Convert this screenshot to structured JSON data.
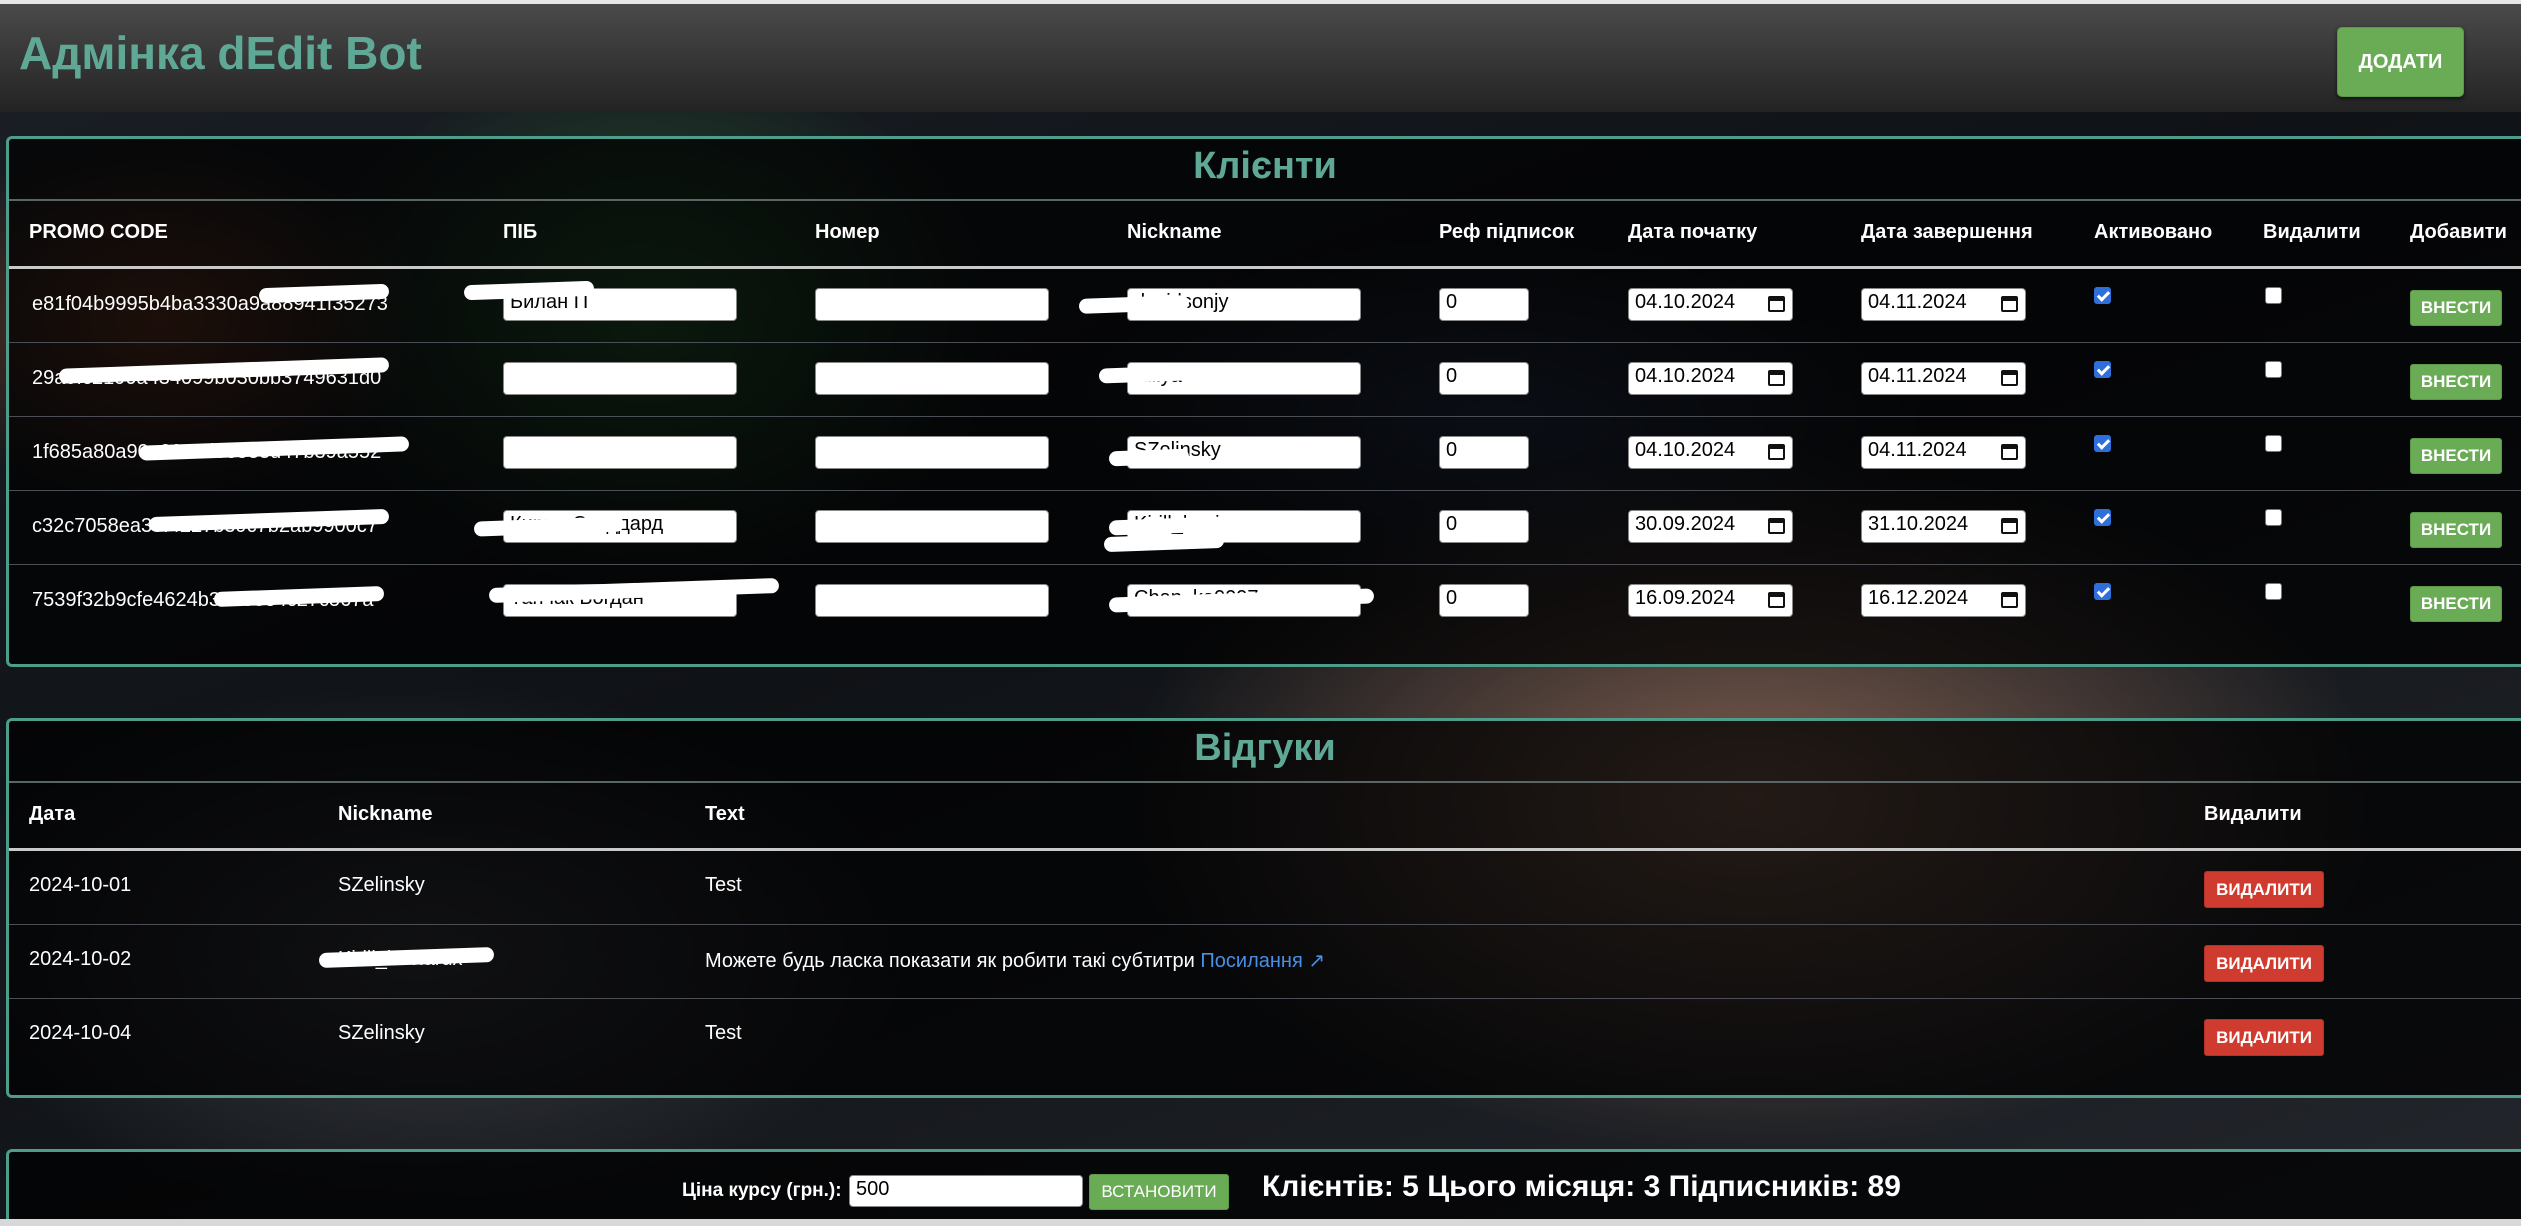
{
  "header": {
    "title": "Адмінка dEdit Bot",
    "add_button": "ДОДАТИ"
  },
  "clients": {
    "title": "Клієнти",
    "columns": [
      "PROMO CODE",
      "ПІБ",
      "Номер",
      "Nickname",
      "Реф підписок",
      "Дата початку",
      "Дата завершення",
      "Активовано",
      "Видалити",
      "Добавити"
    ],
    "submit_label": "ВНЕСТИ",
    "rows": [
      {
        "promo": "e81f04b9995b4ba3330a9a88941f35273",
        "name": "Билан П",
        "phone": "",
        "nickname": "davidsonjy",
        "ref": "0",
        "start": "04.10.2024",
        "end": "04.11.2024",
        "activated": true,
        "delete": false
      },
      {
        "promo": "29a9fc2190a434099b030bb3749631d0",
        "name": "",
        "phone": "",
        "nickname": "Kiilya",
        "ref": "0",
        "start": "04.10.2024",
        "end": "04.11.2024",
        "activated": true,
        "delete": false
      },
      {
        "promo": "1f685a80a90e00c5d6e533d47b39a552",
        "name": "",
        "phone": "",
        "nickname": "SZelinsky",
        "ref": "0",
        "start": "04.10.2024",
        "end": "04.11.2024",
        "activated": true,
        "delete": false
      },
      {
        "promo": "c32c7058ea39f4227b39c7b2ab9900c7",
        "name": "Кирил Стоддард",
        "phone": "",
        "nickname": "Kirill_bovlarux",
        "ref": "0",
        "start": "30.09.2024",
        "end": "31.10.2024",
        "activated": true,
        "delete": false
      },
      {
        "promo": "7539f32b9cfe4624b39a03e4c27c567a",
        "name": "Танчак Богдан",
        "phone": "",
        "nickname": "Chan_ka0097",
        "ref": "0",
        "start": "16.09.2024",
        "end": "16.12.2024",
        "activated": true,
        "delete": false
      }
    ]
  },
  "reviews": {
    "title": "Відгуки",
    "columns": [
      "Дата",
      "Nickname",
      "Text",
      "Видалити"
    ],
    "delete_label": "ВИДАЛИТИ",
    "rows": [
      {
        "date": "2024-10-01",
        "nickname": "SZelinsky",
        "text": "Test",
        "link": ""
      },
      {
        "date": "2024-10-02",
        "nickname": "Kirill_bovlarux",
        "text": "Можете будь ласка показати як робити такі субтитри",
        "link": "Посилання ↗"
      },
      {
        "date": "2024-10-04",
        "nickname": "SZelinsky",
        "text": "Test",
        "link": ""
      }
    ]
  },
  "footer": {
    "price_label": "Ціна курсу (грн.):",
    "price_value": "500",
    "set_button": "ВСТАНОВИТИ",
    "stats": "Клієнтів: 5 Цього місяця: 3 Підписників: 89"
  },
  "colors": {
    "accent": "#5fa896",
    "green_button": "#6aab55",
    "red_button": "#cf3b2e",
    "panel_border": "#4e9c8a"
  }
}
